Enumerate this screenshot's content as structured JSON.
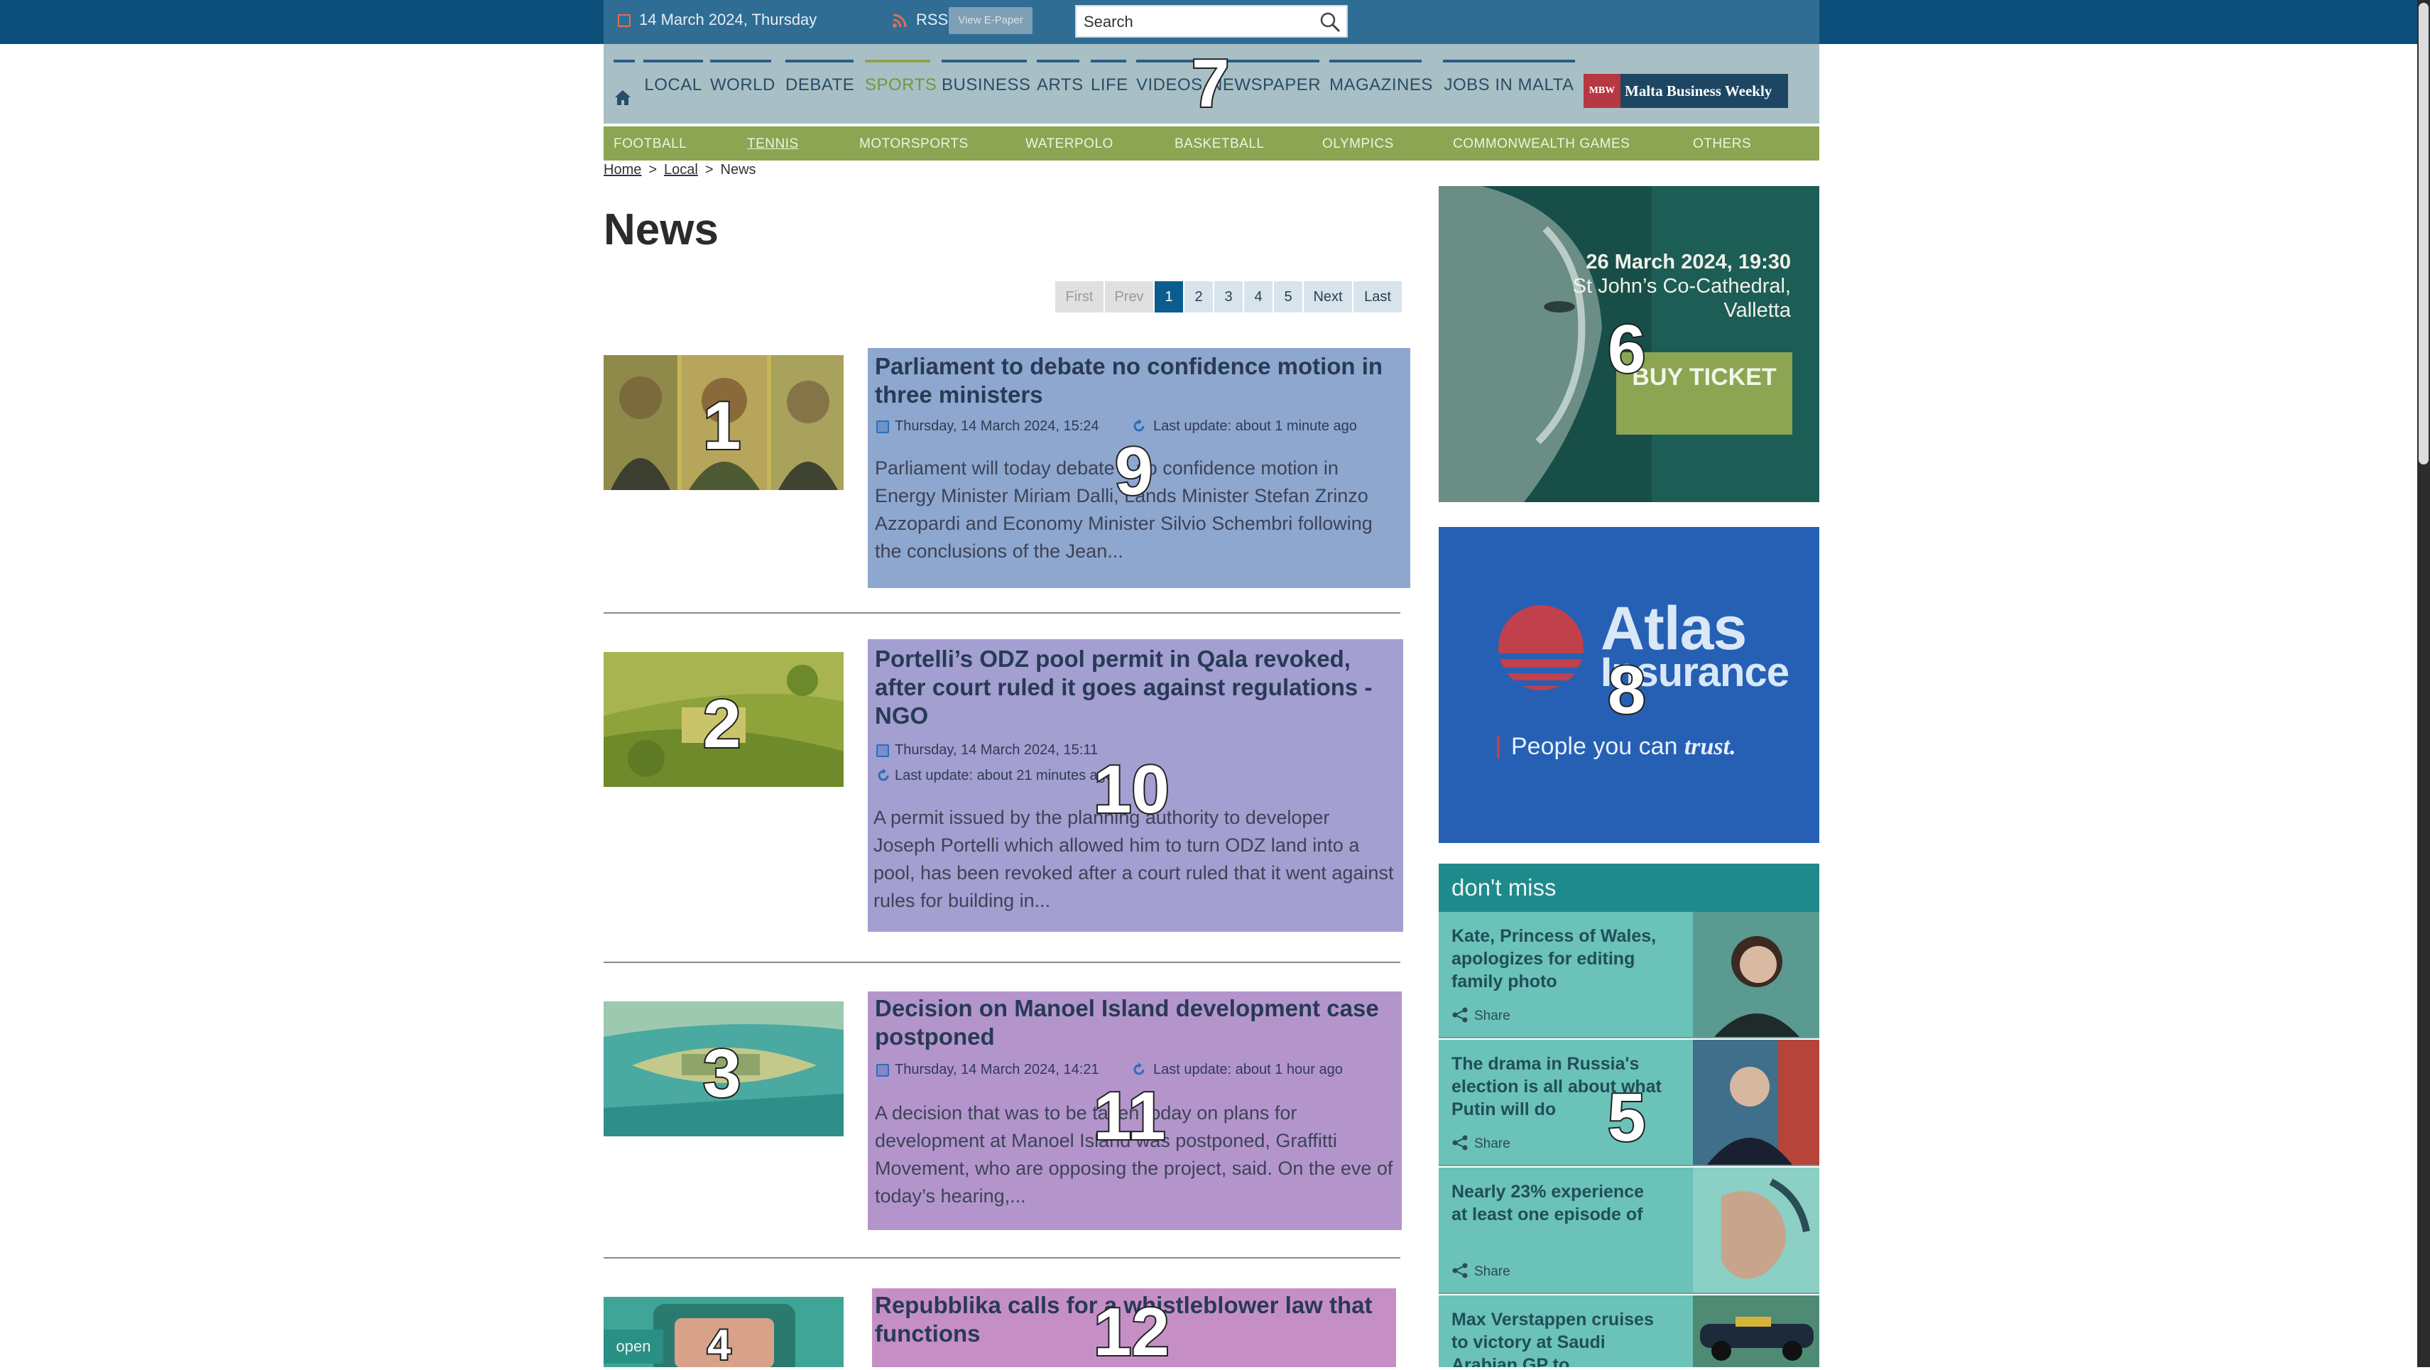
{
  "header": {
    "date": "14 March 2024, Thursday",
    "rss_label": "RSS",
    "epaper_label": "View E-Paper",
    "search_placeholder": "Search"
  },
  "nav": {
    "items": [
      {
        "label": "LOCAL"
      },
      {
        "label": "WORLD"
      },
      {
        "label": "DEBATE"
      },
      {
        "label": "SPORTS",
        "active": true
      },
      {
        "label": "BUSINESS"
      },
      {
        "label": "ARTS"
      },
      {
        "label": "LIFE"
      },
      {
        "label": "VIDEOS"
      },
      {
        "label": "NEWSPAPER"
      },
      {
        "label": "MAGAZINES"
      },
      {
        "label": "JOBS IN MALTA"
      }
    ],
    "mbw_logo": "MBW",
    "mbw_label": "Malta Business Weekly"
  },
  "subnav": {
    "items": [
      "FOOTBALL",
      "TENNIS",
      "MOTORSPORTS",
      "WATERPOLO",
      "BASKETBALL",
      "OLYMPICS",
      "COMMONWEALTH GAMES",
      "OTHERS"
    ]
  },
  "breadcrumb": {
    "home": "Home",
    "local": "Local",
    "current": "News",
    "sep": ">"
  },
  "page_title": "News",
  "pagination": {
    "first": "First",
    "prev": "Prev",
    "pages": [
      "1",
      "2",
      "3",
      "4",
      "5"
    ],
    "current": "1",
    "next": "Next",
    "last": "Last"
  },
  "articles": [
    {
      "title": "Parliament to debate no confidence motion in three ministers",
      "date": "Thursday, 14 March 2024, 15:24",
      "update": "Last update: about 1 minute ago",
      "excerpt": "Parliament will today debate a no confidence motion in Energy Minister Miriam Dalli, Lands Minister Stefan Zrinzo Azzopardi and Economy Minister Silvio Schembri following the conclusions of the Jean...",
      "box_color": "#8ea7cf"
    },
    {
      "title": "Portelli’s ODZ pool permit in Qala revoked, after court ruled it goes against regulations - NGO",
      "date": "Thursday, 14 March 2024, 15:11",
      "update": "Last update: about 21 minutes ago",
      "excerpt": "A permit issued by the planning authority to developer Joseph Portelli which allowed him to turn ODZ land into a pool, has been revoked after a court ruled that it went against rules for building in...",
      "box_color": "#a39fd0"
    },
    {
      "title": "Decision on Manoel Island development case postponed",
      "date": "Thursday, 14 March 2024, 14:21",
      "update": "Last update: about 1 hour ago",
      "excerpt": "A decision that was to be taken today on plans for development at Manoel Island was postponed, Graffitti Movement, who are opposing the project, said. On the eve of today’s hearing,...",
      "box_color": "#b395cc"
    },
    {
      "title": "Repubblika calls for a whistleblower law that functions",
      "box_color": "#c58fc6",
      "open_tag": "open"
    }
  ],
  "ads": {
    "concert": {
      "date": "26 March 2024, 19:30",
      "venue_line1": "St John’s Co-Cathedral,",
      "venue_line2": "Valletta",
      "button": "BUY TICKET"
    },
    "atlas": {
      "brand_line1": "Atlas",
      "brand_line2": "Insurance",
      "tagline_plain": "People you can ",
      "tagline_em": "trust."
    }
  },
  "dont_miss": {
    "heading": "don't miss",
    "share_label": "Share",
    "items": [
      {
        "title": "Kate, Princess of Wales, apologizes for editing family photo"
      },
      {
        "title": "The drama in Russia's election is all about what Putin will do"
      },
      {
        "title": "Nearly 23% experience at least one episode of"
      },
      {
        "title": "Max Verstappen cruises to victory at Saudi Arabian GP to"
      }
    ]
  },
  "overlay_labels": [
    "1",
    "2",
    "3",
    "4",
    "5",
    "6",
    "7",
    "8",
    "9",
    "10",
    "11",
    "12"
  ],
  "colors": {
    "topbar": "#0b4f7a",
    "nav_bg": "#a9bfc6",
    "accent_green": "#8ba552",
    "nav_text": "#294d66",
    "dont_miss_header": "#1f8a8c",
    "dont_miss_item": "#6bc2b8"
  }
}
